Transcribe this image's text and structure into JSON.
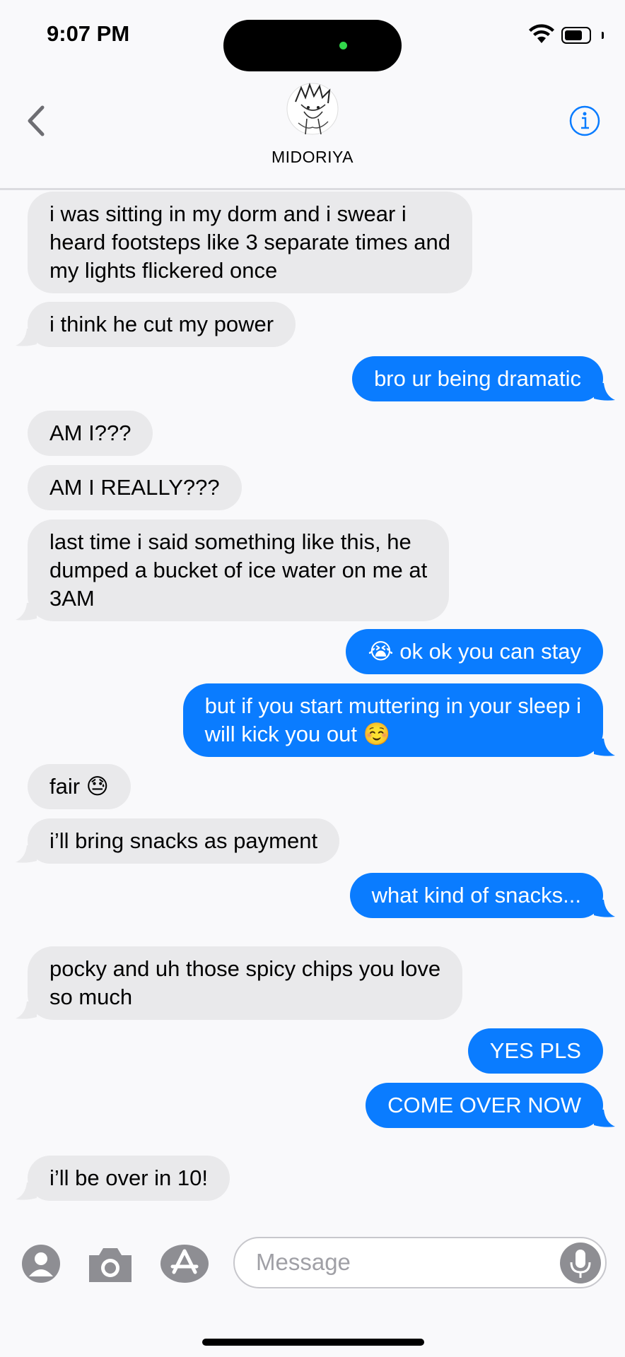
{
  "status": {
    "time": "9:07 PM"
  },
  "header": {
    "contact_name": "MIDORIYA"
  },
  "messages": [
    {
      "dir": "in",
      "text": "i was sitting in my dorm and i swear i\nheard footsteps like 3 separate times and\nmy lights flickered once"
    },
    {
      "dir": "in",
      "text": "i think he cut my power"
    },
    {
      "dir": "out",
      "text": "bro ur being dramatic"
    },
    {
      "dir": "in",
      "text": "AM I???"
    },
    {
      "dir": "in",
      "text": "AM I REALLY???"
    },
    {
      "dir": "in",
      "text": "last time i said something like this, he\ndumped a bucket of ice water on me at\n3AM"
    },
    {
      "dir": "out",
      "text": "😭 ok ok you can stay"
    },
    {
      "dir": "out",
      "text": "but if you start muttering in your sleep i\nwill kick you out ☺️"
    },
    {
      "dir": "in",
      "text": "fair 😓"
    },
    {
      "dir": "in",
      "text": "i’ll bring snacks as payment"
    },
    {
      "dir": "out",
      "text": "what kind of snacks..."
    },
    {
      "dir": "in",
      "text": "pocky and uh those spicy chips you love\nso much"
    },
    {
      "dir": "out",
      "text": "YES PLS"
    },
    {
      "dir": "out",
      "text": "COME OVER NOW"
    },
    {
      "dir": "in",
      "text": "i’ll be over in 10!"
    }
  ],
  "input": {
    "placeholder": "Message"
  },
  "colors": {
    "outgoing": "#0a7cff",
    "incoming": "#e9e9eb",
    "accent": "#0a7cff"
  },
  "icons": [
    "back-chevron-icon",
    "info-icon",
    "contacts-icon",
    "camera-icon",
    "app-store-icon",
    "microphone-icon",
    "wifi-icon",
    "battery-icon"
  ]
}
